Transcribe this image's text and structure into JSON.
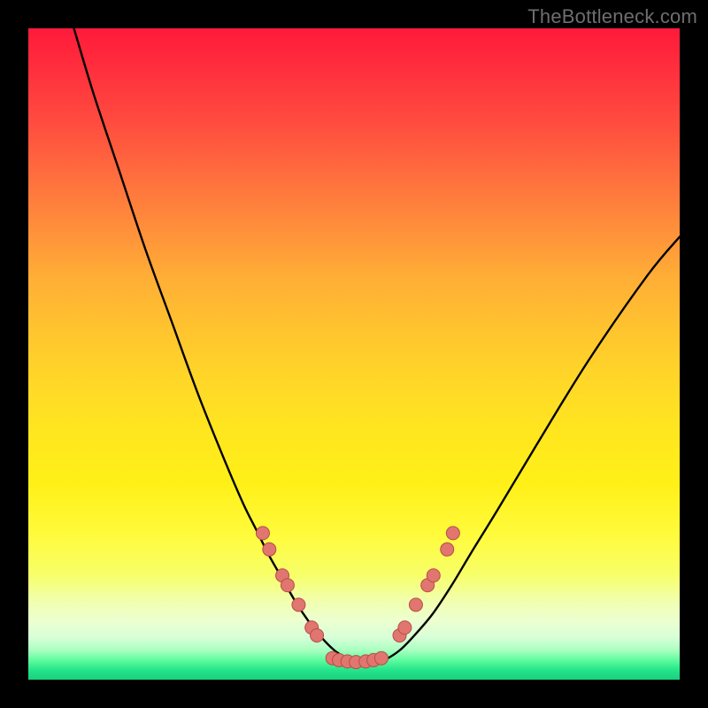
{
  "watermark": "TheBottleneck.com",
  "colors": {
    "background": "#000000",
    "curve": "#000000",
    "dot_fill": "#e0766f",
    "dot_stroke": "#b84d46",
    "gradient_top": "#ff1a3a",
    "gradient_bottom": "#1ad07e"
  },
  "chart_data": {
    "type": "line",
    "title": "",
    "xlabel": "",
    "ylabel": "",
    "xlim": [
      0,
      100
    ],
    "ylim": [
      0,
      100
    ],
    "grid": false,
    "legend": false,
    "note": "No axis ticks or numeric labels are shown; x/y values are in percent of plot width/height, y=0 at bottom. Curve estimated from pixels.",
    "series": [
      {
        "name": "bottleneck-curve",
        "x": [
          7,
          10,
          14,
          18,
          22,
          26,
          30,
          33,
          35,
          37,
          39,
          41,
          43,
          45,
          47,
          49,
          51,
          53,
          55,
          57,
          59,
          62,
          65,
          68,
          72,
          78,
          86,
          95,
          100
        ],
        "y": [
          100,
          90,
          78,
          66,
          55,
          44,
          34,
          27,
          23,
          19,
          15.5,
          12,
          9,
          6.5,
          4.5,
          3.2,
          2.5,
          2.5,
          3.2,
          4.5,
          6.5,
          10,
          14.5,
          19.5,
          26,
          36,
          49,
          62,
          68
        ]
      }
    ],
    "markers": [
      {
        "x": 36.0,
        "y": 22.5
      },
      {
        "x": 37.0,
        "y": 20.0
      },
      {
        "x": 39.0,
        "y": 16.0
      },
      {
        "x": 39.8,
        "y": 14.5
      },
      {
        "x": 41.5,
        "y": 11.5
      },
      {
        "x": 43.5,
        "y": 8.0
      },
      {
        "x": 44.3,
        "y": 6.8
      },
      {
        "x": 46.7,
        "y": 3.3
      },
      {
        "x": 47.7,
        "y": 3.0
      },
      {
        "x": 49.0,
        "y": 2.8
      },
      {
        "x": 50.3,
        "y": 2.7
      },
      {
        "x": 51.8,
        "y": 2.8
      },
      {
        "x": 53.0,
        "y": 3.0
      },
      {
        "x": 54.2,
        "y": 3.3
      },
      {
        "x": 57.0,
        "y": 6.8
      },
      {
        "x": 57.8,
        "y": 8.0
      },
      {
        "x": 59.5,
        "y": 11.5
      },
      {
        "x": 61.3,
        "y": 14.5
      },
      {
        "x": 62.2,
        "y": 16.0
      },
      {
        "x": 64.3,
        "y": 20.0
      },
      {
        "x": 65.2,
        "y": 22.5
      }
    ]
  }
}
